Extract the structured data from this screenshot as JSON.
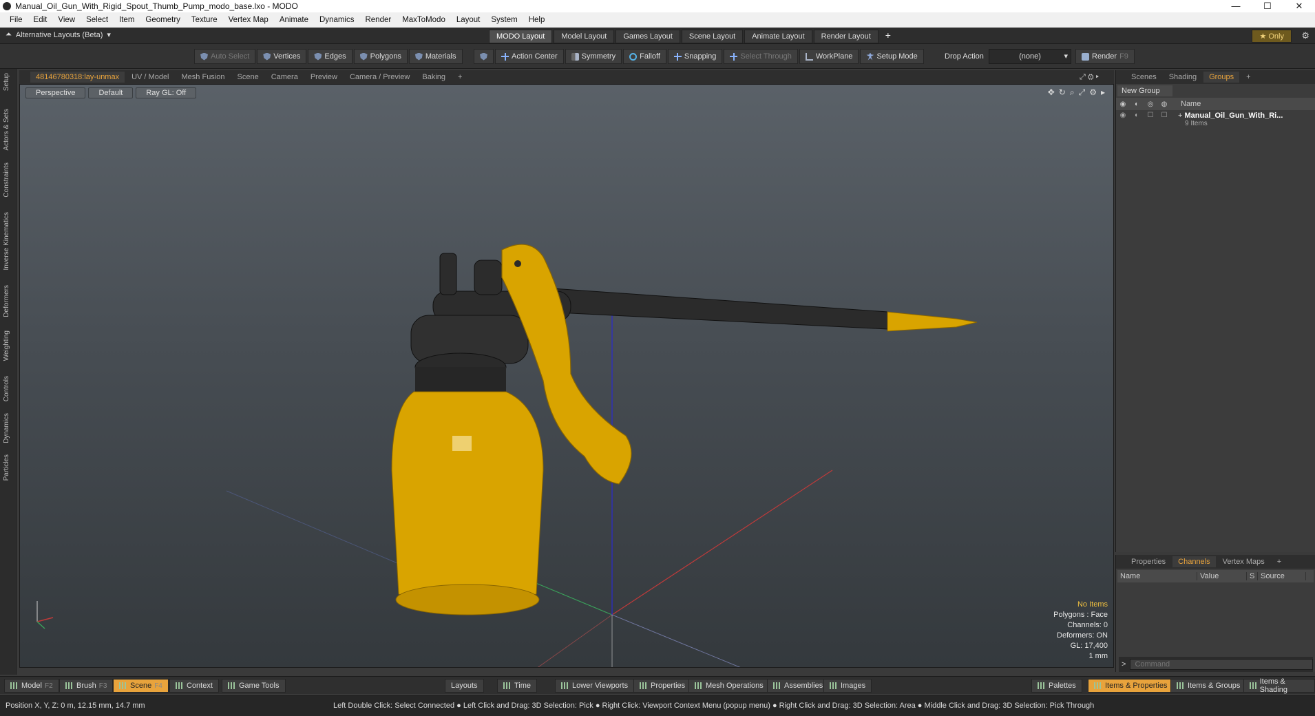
{
  "window": {
    "title": "Manual_Oil_Gun_With_Rigid_Spout_Thumb_Pump_modo_base.lxo - MODO",
    "minimize": "—",
    "maximize": "☐",
    "close": "✕"
  },
  "menu": [
    "File",
    "Edit",
    "View",
    "Select",
    "Item",
    "Geometry",
    "Texture",
    "Vertex Map",
    "Animate",
    "Dynamics",
    "Render",
    "MaxToModo",
    "Layout",
    "System",
    "Help"
  ],
  "layouts": {
    "alt": "Alternative Layouts (Beta)",
    "tabs": [
      "MODO Layout",
      "Model Layout",
      "Games Layout",
      "Scene Layout",
      "Animate Layout",
      "Render Layout"
    ],
    "plus": "+",
    "only": "Only"
  },
  "toolbar": {
    "auto_select": "Auto Select",
    "vertices": "Vertices",
    "edges": "Edges",
    "polygons": "Polygons",
    "materials": "Materials",
    "action_center": "Action Center",
    "symmetry": "Symmetry",
    "falloff": "Falloff",
    "snapping": "Snapping",
    "select_through": "Select Through",
    "workplane": "WorkPlane",
    "setup_mode": "Setup Mode",
    "drop_action": "Drop Action",
    "drop_value": "(none)",
    "render": "Render",
    "render_key": "F9"
  },
  "left_strip": [
    "Setup",
    "Actors & Sets",
    "Constraints",
    "Inverse Kinematics",
    "Deformers",
    "Weighting",
    "Controls",
    "Dynamics",
    "Particles"
  ],
  "viewport_tabs": [
    "48146780318:lay-unmax",
    "UV / Model",
    "Mesh Fusion",
    "Scene",
    "Camera",
    "Preview",
    "Camera / Preview",
    "Baking",
    "+"
  ],
  "viewport": {
    "view": "Perspective",
    "shading": "Default",
    "raygl": "Ray GL: Off",
    "stats": {
      "items": "No Items",
      "polygons": "Polygons : Face",
      "channels": "Channels: 0",
      "deformers": "Deformers: ON",
      "gl": "GL: 17,400",
      "unit": "1 mm"
    }
  },
  "right_panel": {
    "tabs": [
      "Scenes",
      "Shading",
      "Groups",
      "+"
    ],
    "new_group": "New Group",
    "col_name": "Name",
    "group_name": "Manual_Oil_Gun_With_Ri...",
    "group_items": "9 Items"
  },
  "channels_panel": {
    "tabs": [
      "Properties",
      "Channels",
      "Vertex Maps",
      "+"
    ],
    "cols": [
      "Name",
      "Value",
      "S",
      "Source"
    ],
    "command_placeholder": "Command"
  },
  "bottom": {
    "model": "Model",
    "model_key": "F2",
    "brush": "Brush",
    "brush_key": "F3",
    "scene": "Scene",
    "scene_key": "F4",
    "context": "Context",
    "game_tools": "Game Tools",
    "layouts": "Layouts",
    "time": "Time",
    "lower_viewports": "Lower Viewports",
    "properties": "Properties",
    "mesh_operations": "Mesh Operations",
    "assemblies": "Assemblies",
    "images": "Images",
    "palettes": "Palettes",
    "items_properties": "Items & Properties",
    "items_groups": "Items & Groups",
    "items_shading": "Items & Shading"
  },
  "status": {
    "position": "Position X, Y, Z:   0 m, 12.15 mm, 14.7 mm",
    "hint": "Left Double Click: Select Connected ● Left Click and Drag: 3D Selection: Pick ● Right Click: Viewport Context Menu (popup menu) ● Right Click and Drag: 3D Selection: Area ● Middle Click and Drag: 3D Selection: Pick Through"
  },
  "colors": {
    "accent": "#e8a33c",
    "model_yellow": "#d9a400",
    "model_dark": "#2a2a2a"
  }
}
